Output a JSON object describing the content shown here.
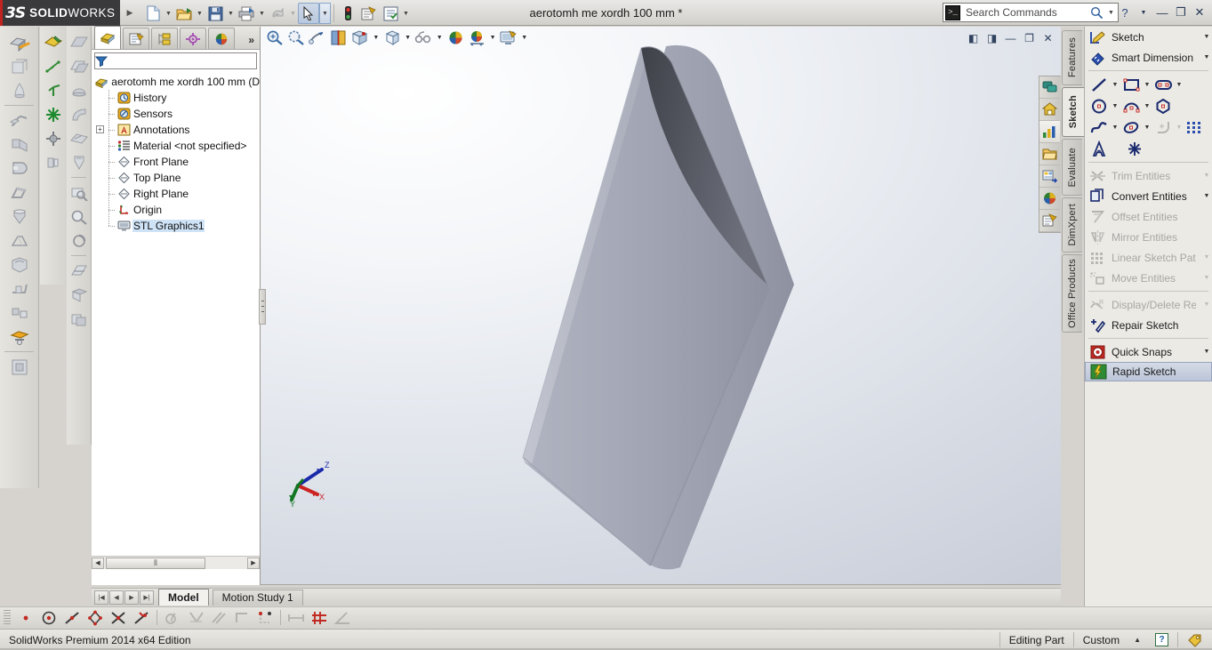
{
  "app": {
    "brand_mark": "3S",
    "brand_name_bold": "SOLID",
    "brand_name_light": "WORKS",
    "document_title": "aerotomh me xordh 100 mm *"
  },
  "search": {
    "placeholder": "Search Commands",
    "icon": "console-icon",
    "magnifier": "search-icon"
  },
  "window_controls": {
    "help": "?",
    "minimize": "—",
    "restore": "❐",
    "close": "✕"
  },
  "main_toolbar": {
    "items": [
      {
        "name": "new-document",
        "icon": "new-file-icon",
        "caret": true
      },
      {
        "name": "open-document",
        "icon": "open-folder-icon",
        "caret": true
      },
      {
        "name": "save-document",
        "icon": "save-disk-icon",
        "caret": true
      },
      {
        "name": "print-document",
        "icon": "printer-icon",
        "caret": true
      },
      {
        "name": "undo",
        "icon": "undo-arrow-icon",
        "caret": true,
        "disabled": true
      },
      {
        "name": "select",
        "icon": "cursor-arrow-icon",
        "caret": true,
        "selected": true
      },
      {
        "name": "rebuild",
        "icon": "traffic-light-icon",
        "caret": false
      },
      {
        "name": "options",
        "icon": "gear-document-icon",
        "caret": false
      },
      {
        "name": "custom-properties",
        "icon": "checklist-icon",
        "caret": true
      }
    ]
  },
  "left_toolbar_a": {
    "items": [
      {
        "name": "extruded-boss-base",
        "icon": "extrude-boss-icon"
      },
      {
        "name": "extruded-cut",
        "icon": "extrude-cut-icon"
      },
      {
        "name": "revolved-boss",
        "icon": "revolve-icon"
      },
      {
        "name": "swept-boss",
        "icon": "sweep-icon"
      },
      {
        "name": "lofted-boss",
        "icon": "loft-icon"
      },
      {
        "name": "fillet",
        "icon": "fillet-icon"
      },
      {
        "name": "chamfer",
        "icon": "chamfer-icon"
      },
      {
        "name": "hole-wizard",
        "icon": "hole-wizard-icon"
      },
      {
        "name": "draft",
        "icon": "draft-icon"
      },
      {
        "name": "shell",
        "icon": "shell-icon"
      },
      {
        "name": "rib",
        "icon": "rib-icon"
      },
      {
        "name": "linear-pattern",
        "icon": "pattern-icon"
      },
      {
        "name": "mirror",
        "icon": "mirror-icon"
      },
      {
        "name": "reference-geometry",
        "icon": "reference-geometry-icon"
      },
      {
        "name": "curves",
        "icon": "curves-icon"
      },
      {
        "name": "instant3d",
        "icon": "instant3d-icon"
      },
      {
        "name": "wrap",
        "icon": "wrap-icon"
      },
      {
        "name": "dome",
        "icon": "dome-icon"
      },
      {
        "name": "move-face",
        "icon": "move-face-icon"
      }
    ]
  },
  "left_toolbar_b": {
    "items": [
      {
        "name": "sketch-plane",
        "icon": "sketch-plane-icon"
      },
      {
        "name": "3d-sketch",
        "icon": "3d-sketch-icon"
      },
      {
        "name": "coordinate-system",
        "icon": "coordinate-system-icon"
      },
      {
        "name": "point",
        "icon": "point-star-icon"
      },
      {
        "name": "center-mark",
        "icon": "center-mark-icon"
      },
      {
        "name": "fastening-feature",
        "icon": "fastening-icon"
      }
    ]
  },
  "left_toolbar_c": {
    "items": [
      {
        "name": "plane",
        "icon": "plane-icon"
      },
      {
        "name": "offset-surface",
        "icon": "offset-surface-icon"
      },
      {
        "name": "revolved-surface",
        "icon": "revolved-surface-icon"
      },
      {
        "name": "swept-surface",
        "icon": "swept-surface-icon"
      },
      {
        "name": "planar-surface",
        "icon": "planar-surface-icon"
      },
      {
        "name": "knit-surface",
        "icon": "knit-surface-icon"
      },
      {
        "name": "zoom-to-fit",
        "icon": "zoom-fit-icon"
      },
      {
        "name": "zoom-to-area",
        "icon": "zoom-area-icon"
      },
      {
        "name": "rotate-view",
        "icon": "rotate-view-icon"
      },
      {
        "name": "section-view",
        "icon": "section-view-icon"
      },
      {
        "name": "display-style",
        "icon": "display-style-icon"
      },
      {
        "name": "hide-show",
        "icon": "hide-show-icon"
      }
    ]
  },
  "feature_tree": {
    "tabs": [
      {
        "name": "feature-manager-tab",
        "icon": "feature-tree-icon",
        "active": true
      },
      {
        "name": "property-manager-tab",
        "icon": "property-manager-icon",
        "active": false
      },
      {
        "name": "configuration-manager-tab",
        "icon": "configuration-manager-icon",
        "active": false
      },
      {
        "name": "dimxpert-manager-tab",
        "icon": "dimxpert-target-icon",
        "active": false
      },
      {
        "name": "display-manager-tab",
        "icon": "display-manager-palette-icon",
        "active": false
      }
    ],
    "overflow": "»",
    "filter_icon": "filter-funnel-icon",
    "filter_value": "",
    "root": {
      "label": "aerotomh me xordh 100 mm  (D",
      "icon": "part-document-icon"
    },
    "nodes": [
      {
        "label": "History",
        "icon": "history-clock-icon",
        "expandable": false
      },
      {
        "label": "Sensors",
        "icon": "sensors-icon",
        "expandable": false
      },
      {
        "label": "Annotations",
        "icon": "annotations-A-icon",
        "expandable": true
      },
      {
        "label": "Material <not specified>",
        "icon": "material-icon",
        "expandable": false
      },
      {
        "label": "Front Plane",
        "icon": "plane-diamond-icon",
        "expandable": false
      },
      {
        "label": "Top Plane",
        "icon": "plane-diamond-icon",
        "expandable": false
      },
      {
        "label": "Right Plane",
        "icon": "plane-diamond-icon",
        "expandable": false
      },
      {
        "label": "Origin",
        "icon": "origin-axes-icon",
        "expandable": false
      },
      {
        "label": "STL Graphics1",
        "icon": "stl-graphics-icon",
        "expandable": false,
        "selected": true
      }
    ],
    "scrollbar": {
      "left_arrow": "◀",
      "right_arrow": "▶",
      "thumb": "⦀"
    }
  },
  "view_toolbar": {
    "items": [
      {
        "name": "zoom-to-fit",
        "icon": "zoom-fit-icon",
        "caret": false
      },
      {
        "name": "zoom-to-area",
        "icon": "zoom-area-icon",
        "caret": false
      },
      {
        "name": "previous-view",
        "icon": "previous-view-icon",
        "caret": false
      },
      {
        "name": "section-view",
        "icon": "section-view-icon",
        "caret": false
      },
      {
        "name": "view-orientation",
        "icon": "view-orientation-icon",
        "caret": true
      },
      {
        "name": "display-style",
        "icon": "display-style-cube-icon",
        "caret": true
      },
      {
        "name": "hide-show-items",
        "icon": "hide-show-glasses-icon",
        "caret": true
      },
      {
        "name": "edit-appearance",
        "icon": "appearance-sphere-icon",
        "caret": false
      },
      {
        "name": "apply-scene",
        "icon": "apply-scene-icon",
        "caret": true
      },
      {
        "name": "view-settings",
        "icon": "view-settings-icon",
        "caret": true
      }
    ]
  },
  "document_window_controls": {
    "items": [
      {
        "name": "restore-left-icon",
        "glyph": "◧"
      },
      {
        "name": "restore-right-icon",
        "glyph": "◨"
      },
      {
        "name": "minimize-document",
        "glyph": "—"
      },
      {
        "name": "restore-document",
        "glyph": "❐"
      },
      {
        "name": "close-document",
        "glyph": "✕"
      }
    ]
  },
  "task_pane": {
    "items": [
      {
        "name": "solidworks-resources",
        "icon": "resources-chat-icon"
      },
      {
        "name": "design-library",
        "icon": "home-library-icon"
      },
      {
        "name": "file-explorer",
        "icon": "charts-explorer-icon",
        "active": true
      },
      {
        "name": "search-folder",
        "icon": "folder-icon"
      },
      {
        "name": "view-palette",
        "icon": "view-palette-icon"
      },
      {
        "name": "appearances-scenes",
        "icon": "appearances-sphere-icon"
      },
      {
        "name": "custom-properties",
        "icon": "custom-properties-icon"
      }
    ]
  },
  "command_tabs": [
    {
      "label": "Features",
      "active": false
    },
    {
      "label": "Sketch",
      "active": true
    },
    {
      "label": "Evaluate",
      "active": false
    },
    {
      "label": "DimXpert",
      "active": false
    },
    {
      "label": "Office Products",
      "active": false
    }
  ],
  "sketch_panel": {
    "rows_top": [
      {
        "label": "Sketch",
        "icon": "sketch-pencil-icon",
        "caret": true,
        "disabled": false
      },
      {
        "label": "Smart Dimension",
        "icon": "smart-dimension-icon",
        "caret": true,
        "disabled": false
      }
    ],
    "grid_rows": [
      [
        {
          "name": "line-tool",
          "icon": "line-icon",
          "caret": true
        },
        {
          "name": "rectangle-tool",
          "icon": "rectangle-icon",
          "caret": true
        },
        {
          "name": "slot-tool",
          "icon": "slot-icon",
          "caret": true
        }
      ],
      [
        {
          "name": "circle-tool",
          "icon": "circle-icon",
          "caret": true
        },
        {
          "name": "arc-tool",
          "icon": "arc-icon",
          "caret": true
        },
        {
          "name": "polygon-tool",
          "icon": "polygon-icon",
          "caret": false
        }
      ],
      [
        {
          "name": "spline-tool",
          "icon": "spline-icon",
          "caret": true
        },
        {
          "name": "ellipse-tool",
          "icon": "ellipse-icon",
          "caret": true
        },
        {
          "name": "sketch-fillet-tool",
          "icon": "sketch-fillet-icon",
          "caret": true,
          "disabled": true
        },
        {
          "name": "sketch-pattern-tool",
          "icon": "sketch-pattern-icon",
          "caret": false
        }
      ],
      [
        {
          "name": "text-tool",
          "icon": "text-A-icon",
          "caret": false
        },
        {
          "name": "point-tool",
          "icon": "point-star-icon",
          "caret": false
        }
      ]
    ],
    "rows_bottom": [
      {
        "label": "Trim Entities",
        "icon": "trim-entities-icon",
        "caret": true,
        "disabled": true
      },
      {
        "label": "Convert Entities",
        "icon": "convert-entities-icon",
        "caret": true,
        "disabled": false
      },
      {
        "label": "Offset Entities",
        "icon": "offset-entities-icon",
        "caret": false,
        "disabled": true
      },
      {
        "label": "Mirror Entities",
        "icon": "mirror-entities-icon",
        "caret": false,
        "disabled": true
      },
      {
        "label": "Linear Sketch Patt...",
        "icon": "linear-sketch-pattern-icon",
        "caret": true,
        "disabled": true
      },
      {
        "label": "Move Entities",
        "icon": "move-entities-icon",
        "caret": true,
        "disabled": true
      }
    ],
    "rows_bottom2": [
      {
        "label": "Display/Delete Rel...",
        "icon": "display-delete-relations-icon",
        "caret": true,
        "disabled": true
      },
      {
        "label": "Repair Sketch",
        "icon": "repair-sketch-icon",
        "caret": false,
        "disabled": false
      }
    ],
    "rows_bottom3": [
      {
        "label": "Quick Snaps",
        "icon": "quick-snaps-icon",
        "caret": true,
        "disabled": false
      },
      {
        "label": "Rapid Sketch",
        "icon": "rapid-sketch-icon",
        "caret": false,
        "disabled": false,
        "highlighted": true
      }
    ]
  },
  "model_tabs": {
    "nav": [
      "|◀",
      "◀",
      "▶",
      "▶|"
    ],
    "tabs": [
      {
        "label": "Model",
        "active": true
      },
      {
        "label": "Motion Study 1",
        "active": false
      }
    ]
  },
  "snap_toolbar": {
    "items": [
      {
        "name": "point-snap",
        "icon": "point-dot-icon"
      },
      {
        "name": "center-point-snap",
        "icon": "center-point-icon"
      },
      {
        "name": "midpoint-snap",
        "icon": "midpoint-line-icon"
      },
      {
        "name": "quadrant-snap",
        "icon": "quadrant-icon"
      },
      {
        "name": "intersection-snap",
        "icon": "intersection-x-icon"
      },
      {
        "name": "nearest-snap",
        "icon": "nearest-icon"
      },
      {
        "name": "tangent-snap",
        "icon": "tangent-icon",
        "disabled": true
      },
      {
        "name": "perpendicular-snap",
        "icon": "perpendicular-icon",
        "disabled": true
      },
      {
        "name": "parallel-snap",
        "icon": "parallel-icon",
        "disabled": true
      },
      {
        "name": "horizontal-vertical-snap",
        "icon": "horizontal-vertical-icon",
        "disabled": true
      },
      {
        "name": "horizontal-vertical-points-snap",
        "icon": "hv-points-icon",
        "disabled": true
      },
      {
        "name": "length-snap",
        "icon": "length-icon",
        "disabled": true
      },
      {
        "name": "grid-snap",
        "icon": "grid-icon",
        "disabled": true
      },
      {
        "name": "angle-snap",
        "icon": "angle-icon",
        "disabled": true
      }
    ]
  },
  "status_bar": {
    "left_text": "SolidWorks Premium 2014 x64 Edition",
    "editing_state": "Editing Part",
    "units": "Custom",
    "units_caret": "▲",
    "help_badge": "?",
    "tag_icon": "tag-icon"
  },
  "viewport": {
    "triad": {
      "x_label": "X",
      "x_color": "#cc2222",
      "y_label": "Y",
      "y_color": "#117722",
      "z_label": "Z",
      "z_color": "#1a2aaa"
    },
    "model": {
      "name": "airfoil-extrusion",
      "face_light": "#aeb2bf",
      "face_mid": "#9498a7",
      "face_dark": "#61636e",
      "edge": "#7c7f8c"
    },
    "background_top": "#ffffff",
    "background_bottom": "#c9ced9"
  }
}
